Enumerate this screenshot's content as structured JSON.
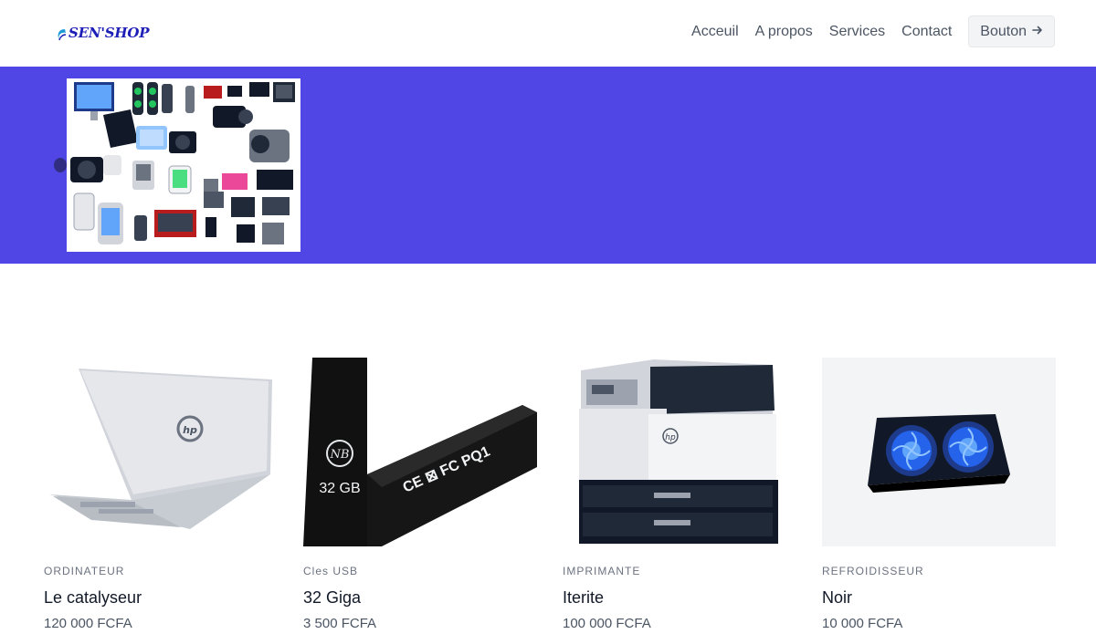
{
  "header": {
    "logo_text": "SEN'SHOP",
    "nav": [
      "Acceuil",
      "A propos",
      "Services",
      "Contact"
    ],
    "button_label": "Bouton",
    "button_icon": "arrow-right-icon"
  },
  "hero": {
    "background": "#4f46e5",
    "image": "electronics-collage-image"
  },
  "products": [
    {
      "category": "ORDINATEUR",
      "name": "Le catalyseur",
      "price": "120 000 FCFA",
      "image": "laptop-image"
    },
    {
      "category": "Cles USB",
      "name": "32 Giga",
      "price": "3 500 FCFA",
      "image": "usb-drive-image",
      "image_text": "32 GB"
    },
    {
      "category": "IMPRIMANTE",
      "name": "Iterite",
      "price": "100 000 FCFA",
      "image": "printer-image"
    },
    {
      "category": "REFROIDISSEUR",
      "name": "Noir",
      "price": "10 000 FCFA",
      "image": "cooling-pad-image"
    }
  ]
}
